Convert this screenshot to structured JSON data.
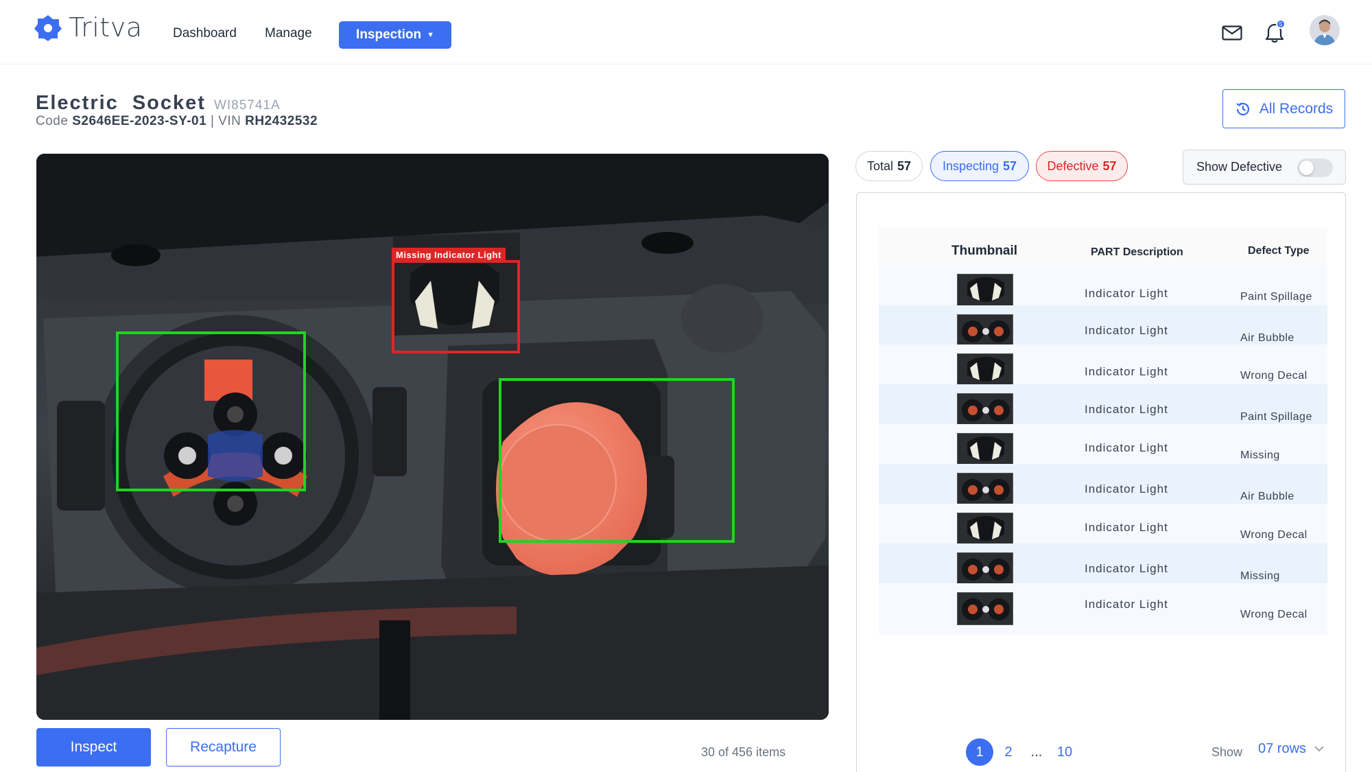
{
  "brand": {
    "name": "Tritva",
    "accent": "#3b6ef0"
  },
  "nav": {
    "dashboard": "Dashboard",
    "manage": "Manage",
    "inspection": "Inspection"
  },
  "header": {
    "notification_count": "5"
  },
  "product": {
    "name": "Electric Socket",
    "id": "WI85741A",
    "code_label": "Code",
    "code": "S2646EE-2023-SY-01",
    "separator": "|",
    "vin_label": "VIN",
    "vin": "RH2432532"
  },
  "all_records_label": "All Records",
  "detection": {
    "label": "Missing Indicator Light",
    "box_colors": {
      "ok": "#22d322",
      "defect": "#dc2626"
    }
  },
  "actions": {
    "inspect": "Inspect",
    "recapture": "Recapture"
  },
  "items_count": "30 of 456 items",
  "filters": {
    "total_label": "Total",
    "total_count": "57",
    "inspecting_label": "Inspecting",
    "inspecting_count": "57",
    "defective_label": "Defective",
    "defective_count": "57",
    "show_defective": "Show Defective",
    "show_defective_on": false
  },
  "table": {
    "headers": {
      "thumbnail": "Thumbnail",
      "part": "PART Description",
      "defect": "Defect Type"
    },
    "rows": [
      {
        "thumb": "indicator-light",
        "part": "Indicator Light",
        "defect": "Paint Spillage"
      },
      {
        "thumb": "socket",
        "part": "Indicator Light",
        "defect": "Air Bubble"
      },
      {
        "thumb": "indicator-light",
        "part": "Indicator Light",
        "defect": "Wrong Decal"
      },
      {
        "thumb": "socket",
        "part": "Indicator Light",
        "defect": "Paint Spillage"
      },
      {
        "thumb": "indicator-light",
        "part": "Indicator Light",
        "defect": "Missing"
      },
      {
        "thumb": "socket",
        "part": "Indicator Light",
        "defect": "Air Bubble"
      },
      {
        "thumb": "indicator-light",
        "part": "Indicator Light",
        "defect": "Wrong Decal"
      },
      {
        "thumb": "socket",
        "part": "Indicator Light",
        "defect": "Missing"
      },
      {
        "thumb": "socket",
        "part": "Indicator Light",
        "defect": "Wrong Decal"
      }
    ]
  },
  "pagination": {
    "pages": [
      "1",
      "2",
      "...",
      "10"
    ],
    "current": "1",
    "show_label": "Show",
    "rows_value": "07 rows"
  }
}
